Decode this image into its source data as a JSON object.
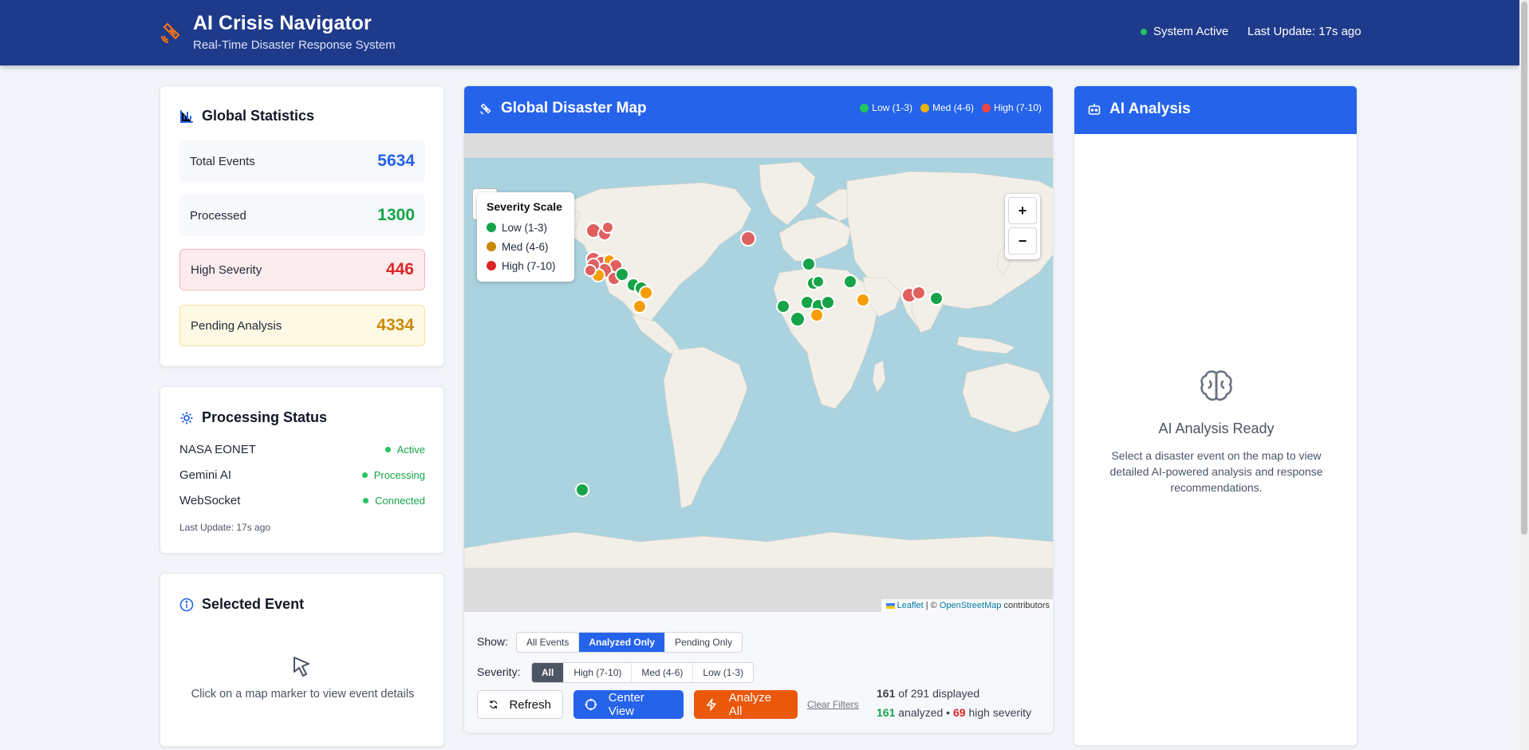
{
  "header": {
    "title": "AI Crisis Navigator",
    "subtitle": "Real-Time Disaster Response System",
    "system_status": "System Active",
    "last_update": "Last Update: 17s ago",
    "logo_icon": "satellite-icon"
  },
  "global_stats": {
    "title": "Global Statistics",
    "items": [
      {
        "label": "Total Events",
        "value": "5634",
        "color": "#2563eb"
      },
      {
        "label": "Processed",
        "value": "1300",
        "color": "#16a34a"
      },
      {
        "label": "High Severity",
        "value": "446",
        "color": "#dc2626"
      },
      {
        "label": "Pending Analysis",
        "value": "4334",
        "color": "#ca8a04"
      }
    ]
  },
  "processing": {
    "title": "Processing Status",
    "items": [
      {
        "label": "NASA EONET",
        "status": "Active"
      },
      {
        "label": "Gemini AI",
        "status": "Processing"
      },
      {
        "label": "WebSocket",
        "status": "Connected"
      }
    ],
    "last_update": "Last Update: 17s ago"
  },
  "selected_event": {
    "title": "Selected Event",
    "hint": "Click on a map marker to view event details"
  },
  "map": {
    "title": "Global Disaster Map",
    "legend": [
      {
        "label": "Low (1-3)",
        "color": "#22c55e"
      },
      {
        "label": "Med (4-6)",
        "color": "#eab308"
      },
      {
        "label": "High (7-10)",
        "color": "#ef4444"
      }
    ],
    "severity_scale": {
      "title": "Severity Scale",
      "items": [
        {
          "label": "Low (1-3)",
          "color": "#16a34a"
        },
        {
          "label": "Med (4-6)",
          "color": "#ca8a04"
        },
        {
          "label": "High (7-10)",
          "color": "#dc2626"
        }
      ]
    },
    "zoom_in": "+",
    "zoom_out": "−",
    "attribution_leaflet": "Leaflet",
    "attribution_sep": " | © ",
    "attribution_osm": "OpenStreetMap",
    "attribution_tail": " contributors"
  },
  "filters": {
    "show_label": "Show:",
    "show_options": [
      "All Events",
      "Analyzed Only",
      "Pending Only"
    ],
    "show_selected": "Analyzed Only",
    "severity_label": "Severity:",
    "severity_options": [
      "All",
      "High (7-10)",
      "Med (4-6)",
      "Low (1-3)"
    ],
    "severity_selected": "All",
    "refresh": "Refresh",
    "center_view": "Center View",
    "analyze_all": "Analyze All",
    "clear_filters": "Clear Filters",
    "displayed": "161",
    "displayed_total": " of 291 displayed",
    "analyzed": "161",
    "analyzed_text": " analyzed • ",
    "high": "69",
    "high_text": " high severity"
  },
  "ai_panel": {
    "title": "AI Analysis",
    "ready": "AI Analysis Ready",
    "description": "Select a disaster event on the map to view detailed AI-powered analysis and response recommendations."
  }
}
